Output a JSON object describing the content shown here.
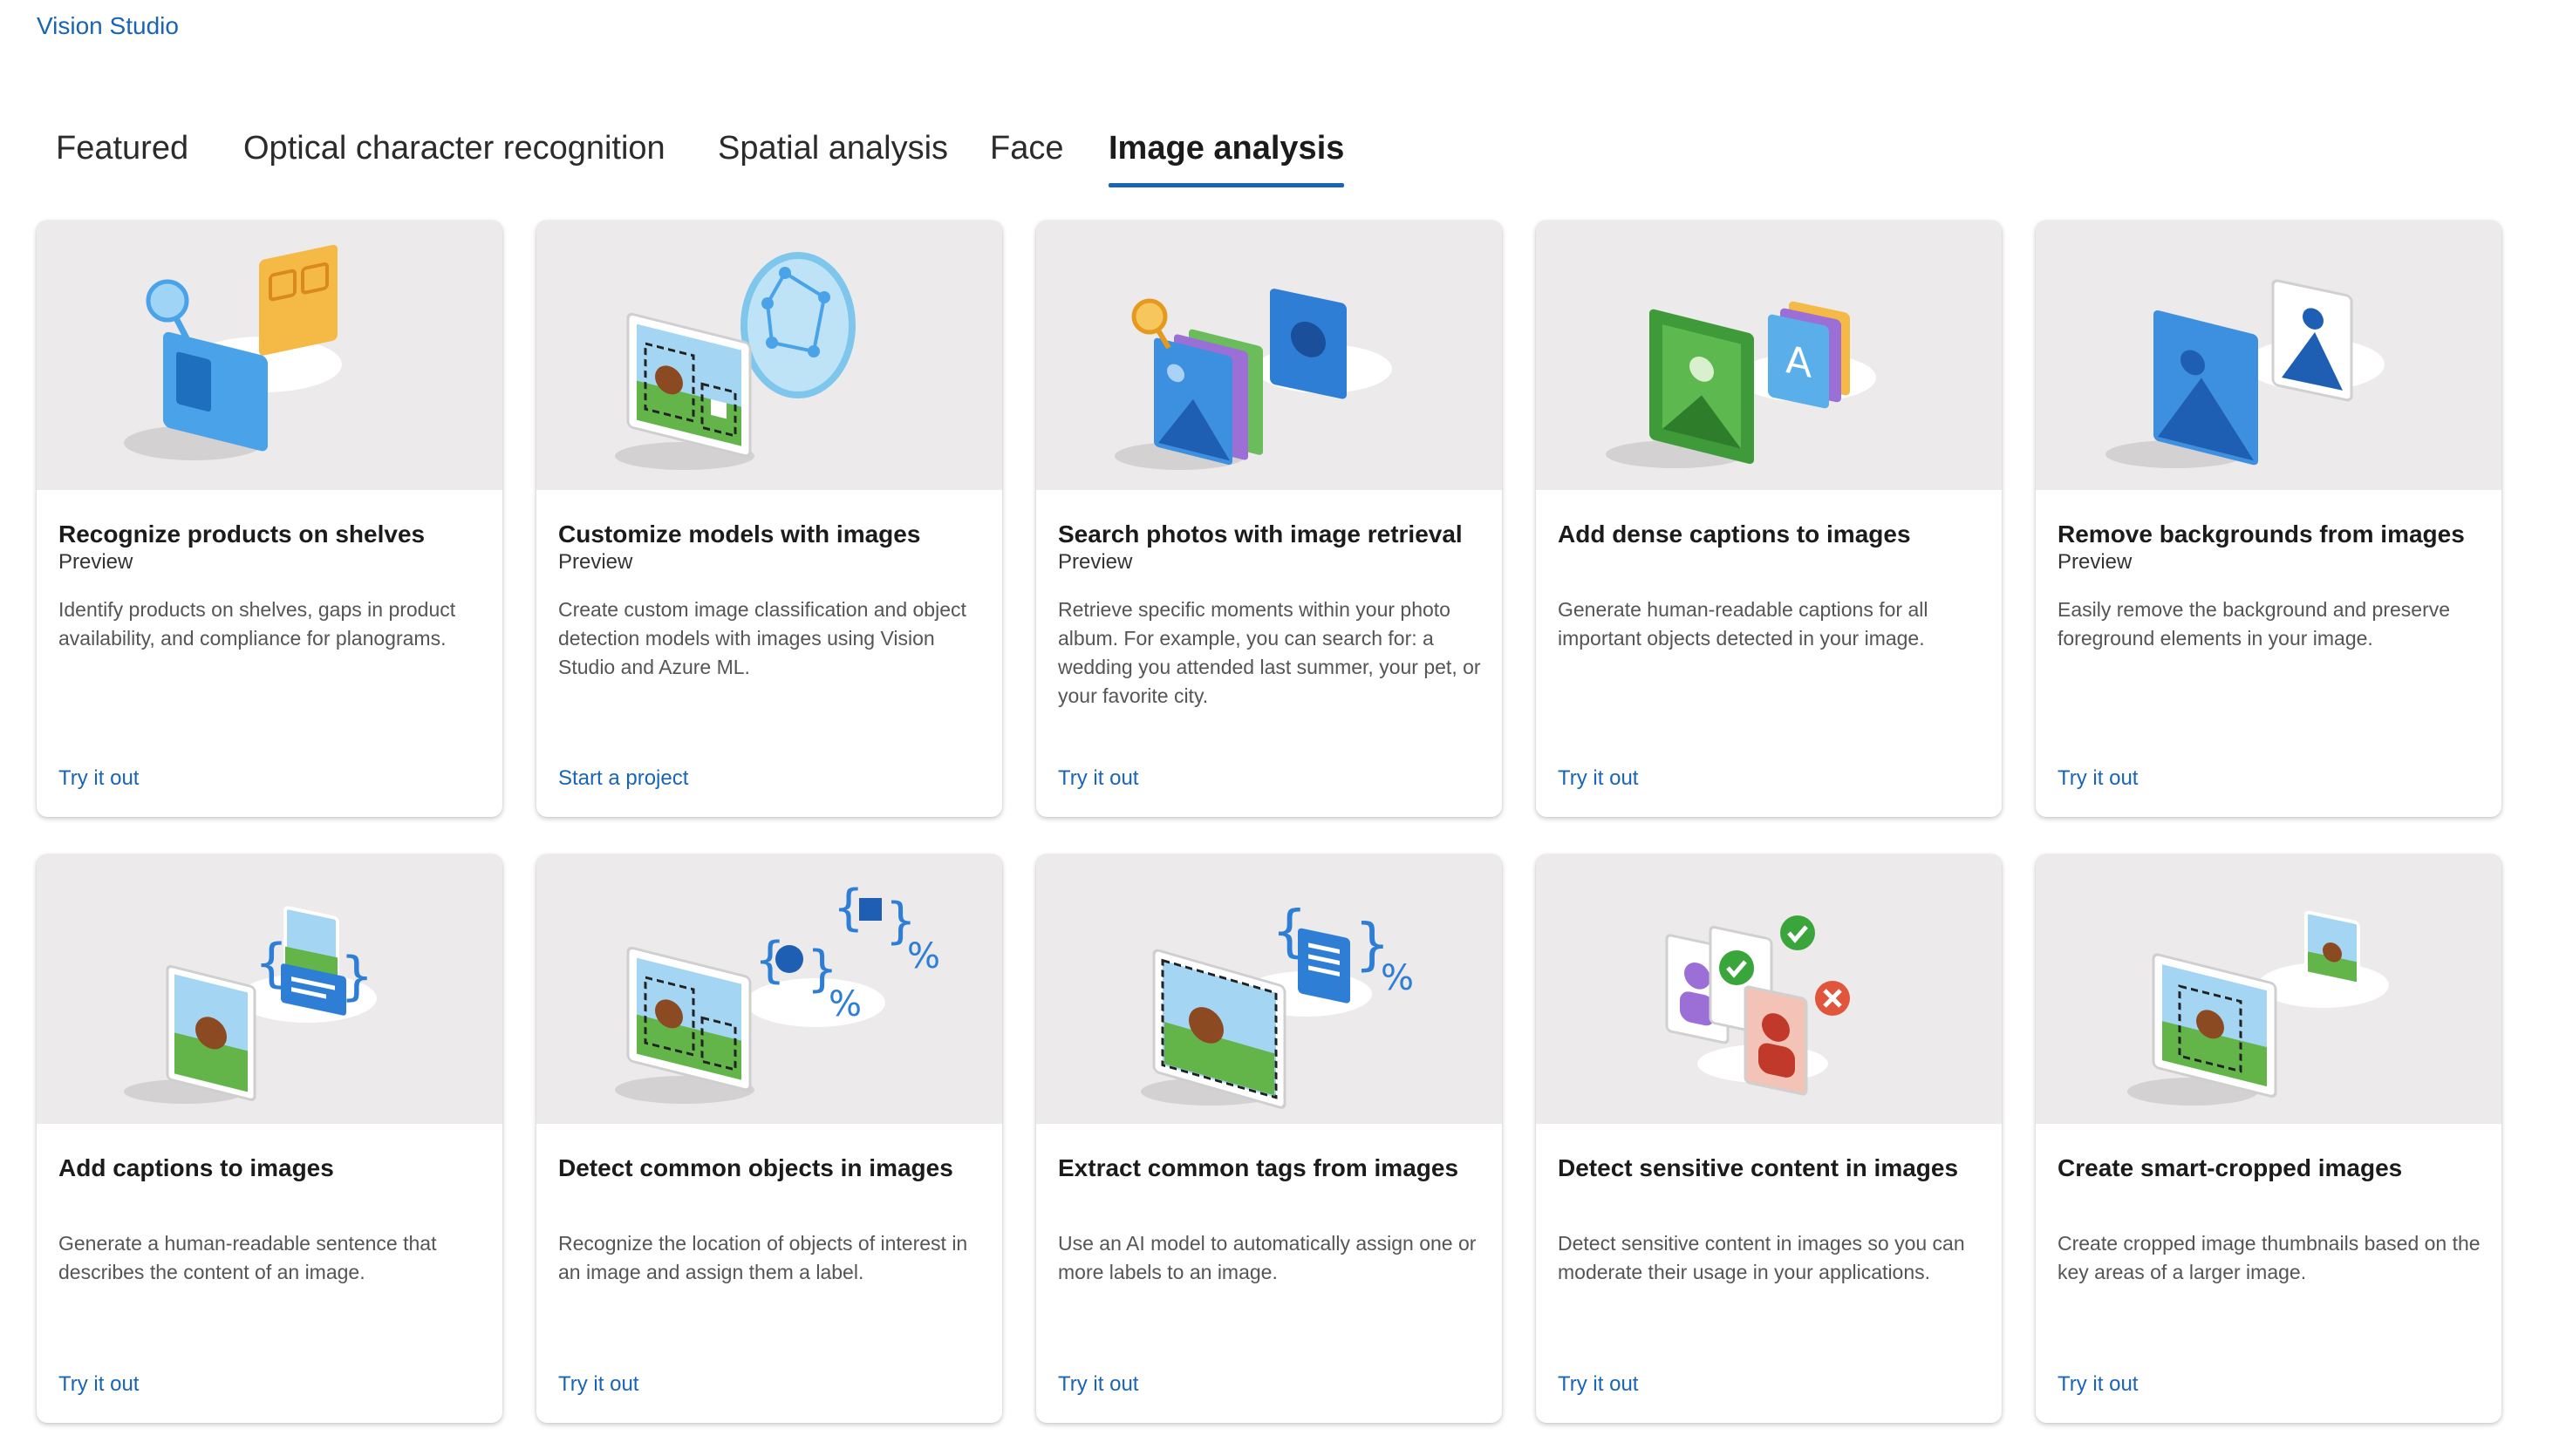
{
  "app": {
    "title": "Vision Studio"
  },
  "tabs": [
    {
      "label": "Featured",
      "active": false
    },
    {
      "label": "Optical character recognition",
      "active": false
    },
    {
      "label": "Spatial analysis",
      "active": false
    },
    {
      "label": "Face",
      "active": false
    },
    {
      "label": "Image analysis",
      "active": true
    }
  ],
  "cards": [
    {
      "title": "Recognize products on shelves",
      "badge": "Preview",
      "description": "Identify products on shelves, gaps in product availability, and compliance for planograms.",
      "action": "Try it out",
      "icon": "product-shelf-icon"
    },
    {
      "title": "Customize models with images",
      "badge": "Preview",
      "description": "Create custom image classification and object detection models with images using Vision Studio and Azure ML.",
      "action": "Start a project",
      "icon": "custom-model-icon"
    },
    {
      "title": "Search photos with image retrieval",
      "badge": "Preview",
      "description": "Retrieve specific moments within your photo album. For example, you can search for: a wedding you attended last summer, your pet, or your favorite city.",
      "action": "Try it out",
      "icon": "image-retrieval-icon"
    },
    {
      "title": "Add dense captions to images",
      "badge": "",
      "description": "Generate human-readable captions for all important objects detected in your image.",
      "action": "Try it out",
      "icon": "dense-captions-icon"
    },
    {
      "title": "Remove backgrounds from images",
      "badge": "Preview",
      "description": "Easily remove the background and preserve foreground elements in your image.",
      "action": "Try it out",
      "icon": "background-removal-icon"
    },
    {
      "title": "Add captions to images",
      "badge": "",
      "description": "Generate a human-readable sentence that describes the content of an image.",
      "action": "Try it out",
      "icon": "image-captions-icon"
    },
    {
      "title": "Detect common objects in images",
      "badge": "",
      "description": "Recognize the location of objects of interest in an image and assign them a label.",
      "action": "Try it out",
      "icon": "object-detection-icon"
    },
    {
      "title": "Extract common tags from images",
      "badge": "",
      "description": "Use an AI model to automatically assign one or more labels to an image.",
      "action": "Try it out",
      "icon": "image-tags-icon"
    },
    {
      "title": "Detect sensitive content in images",
      "badge": "",
      "description": "Detect sensitive content in images so you can moderate their usage in your applications.",
      "action": "Try it out",
      "icon": "content-moderation-icon"
    },
    {
      "title": "Create smart-cropped images",
      "badge": "",
      "description": "Create cropped image thumbnails based on the key areas of a larger image.",
      "action": "Try it out",
      "icon": "smart-crop-icon"
    }
  ],
  "colors": {
    "accent": "#1a64b5",
    "hero_bg": "#eceaea"
  }
}
